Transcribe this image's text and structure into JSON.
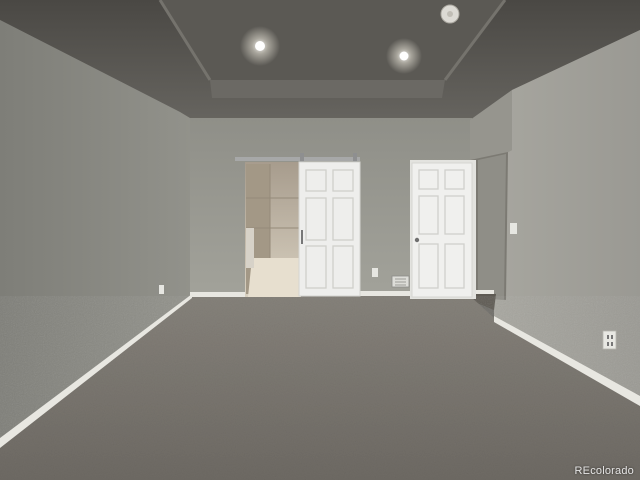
{
  "photo": {
    "subject": "empty-bedroom-interior",
    "watermark": "REcolorado"
  },
  "colors": {
    "ceiling": "#56544f",
    "left_wall": "#8a8a83",
    "back_wall": "#9a9a92",
    "right_wall": "#9c9b95",
    "carpet": "#7a7670",
    "baseboard": "#ecebe6",
    "door": "#eeeeec",
    "bathroom_tile": "#b3a898"
  }
}
